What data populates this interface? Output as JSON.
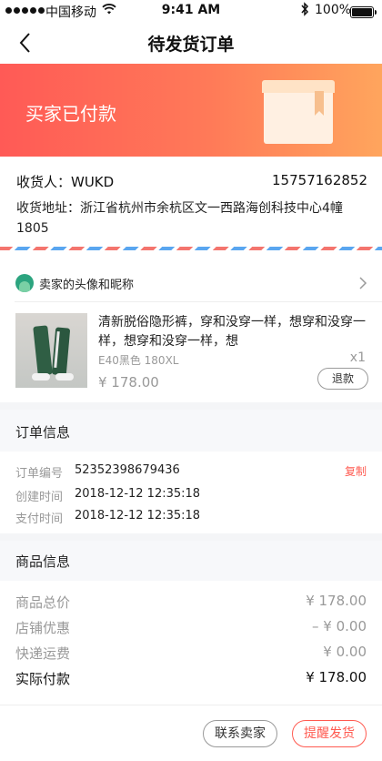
{
  "status_bar": {
    "carrier": "中国移动",
    "time": "9:41 AM",
    "battery": "100%"
  },
  "nav": {
    "title": "待发货订单"
  },
  "banner": {
    "status_text": "买家已付款"
  },
  "address": {
    "receiver": "收货人：WUKD",
    "phone": "15757162852",
    "address": "收货地址：浙江省杭州市余杭区文一西路海创科技中心4幢1805"
  },
  "shop": {
    "name": "卖家的头像和昵称"
  },
  "product": {
    "title": "清新脱俗隐形裤，穿和没穿一样，想穿和没穿一样，想穿和没穿一样，想",
    "spec": "E40黑色 180XL",
    "quantity": "x1",
    "price": "¥ 178.00",
    "refund_label": "退款"
  },
  "order_info": {
    "title": "订单信息",
    "copy_label": "复制",
    "rows": [
      {
        "label": "订单编号",
        "value": "52352398679436"
      },
      {
        "label": "创建时间",
        "value": "2018-12-12 12:35:18"
      },
      {
        "label": "支付时间",
        "value": "2018-12-12 12:35:18"
      }
    ]
  },
  "goods_info": {
    "title": "商品信息",
    "rows": [
      {
        "label": "商品总价",
        "value": "¥ 178.00"
      },
      {
        "label": "店铺优惠",
        "value": "– ¥ 0.00"
      },
      {
        "label": "快递运费",
        "value": "¥ 0.00"
      },
      {
        "label": "实际付款",
        "value": "¥ 178.00"
      }
    ]
  },
  "actions": {
    "contact_seller": "联系卖家",
    "remind_ship": "提醒发货"
  },
  "colors": {
    "accent": "#ff5a50",
    "banner_start": "#ff5a56",
    "banner_end": "#ffa55d"
  }
}
